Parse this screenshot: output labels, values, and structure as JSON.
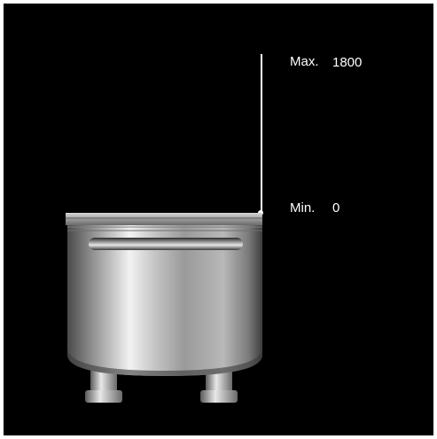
{
  "gauge": {
    "max_label": "Max.",
    "max_value": "1800",
    "min_label": "Min.",
    "min_value": "0"
  },
  "colors": {
    "background": "#000000",
    "scale": "#ffffff",
    "text": "#ffffff"
  },
  "icons": {
    "tank": "stainless-tank-icon"
  }
}
